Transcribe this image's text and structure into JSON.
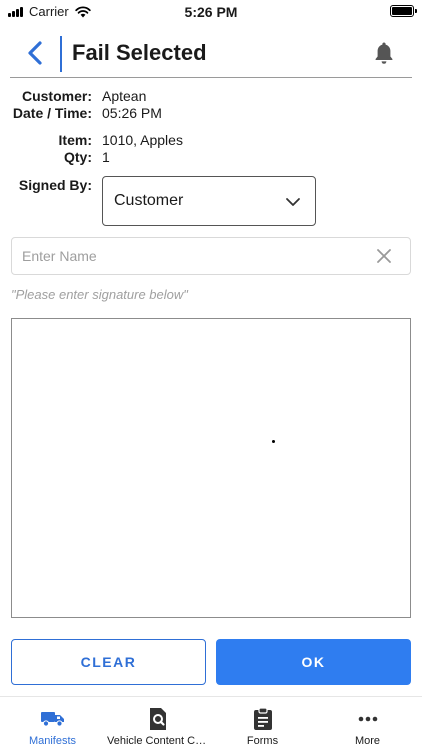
{
  "status_bar": {
    "carrier": "Carrier",
    "time": "5:26 PM"
  },
  "header": {
    "title": "Fail Selected"
  },
  "details": {
    "customer_label": "Customer:",
    "customer_value": "Aptean",
    "datetime_label": "Date / Time:",
    "datetime_value": "05:26 PM",
    "item_label": "Item:",
    "item_value": "1010, Apples",
    "qty_label": "Qty:",
    "qty_value": "1",
    "signed_by_label": "Signed By:"
  },
  "signed_by": {
    "selected": "Customer"
  },
  "name_input": {
    "value": "",
    "placeholder": "Enter Name"
  },
  "signature": {
    "hint": "\"Please enter signature below\""
  },
  "actions": {
    "clear_label": "CLEAR",
    "ok_label": "OK"
  },
  "colors": {
    "accent": "#2f6fd6",
    "primary_button": "#2f7df0"
  },
  "tabbar": {
    "items": [
      {
        "label": "Manifests",
        "icon": "truck-icon",
        "active": true
      },
      {
        "label": "Vehicle Content Ch...",
        "icon": "document-search-icon",
        "active": false
      },
      {
        "label": "Forms",
        "icon": "clipboard-icon",
        "active": false
      },
      {
        "label": "More",
        "icon": "ellipsis-icon",
        "active": false
      }
    ]
  }
}
